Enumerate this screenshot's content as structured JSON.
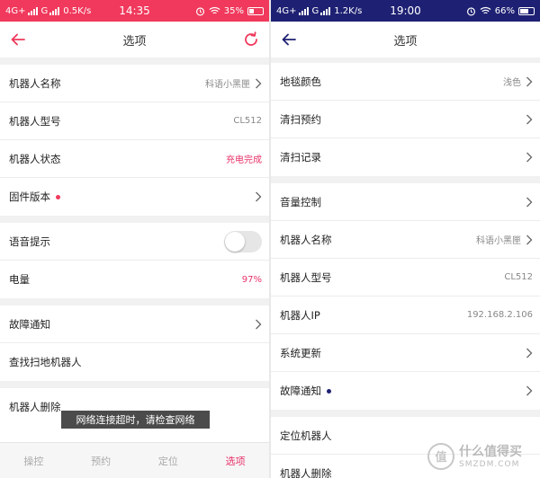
{
  "colors": {
    "left_accent": "#f0395c",
    "right_accent": "#1e2173",
    "value_accent": "#e8336a"
  },
  "left": {
    "status": {
      "network": "4G+",
      "signal2": "G",
      "speed": "0.5K/s",
      "time": "14:35",
      "battery": "35%",
      "battery_level": 0.35
    },
    "header": {
      "title": "选项"
    },
    "rows": {
      "robot_name": {
        "label": "机器人名称",
        "value": "科语小黑匣"
      },
      "robot_model": {
        "label": "机器人型号",
        "value": "CL512"
      },
      "robot_status": {
        "label": "机器人状态",
        "value": "充电完成"
      },
      "firmware": {
        "label": "固件版本"
      },
      "voice_prompt": {
        "label": "语音提示",
        "enabled": false
      },
      "battery": {
        "label": "电量",
        "value": "97%"
      },
      "fault_notice": {
        "label": "故障通知"
      },
      "find_robot": {
        "label": "查找扫地机器人"
      },
      "delete_robot": {
        "label": "机器人删除"
      }
    },
    "toast": "网络连接超时，请检查网络",
    "tabs": [
      "操控",
      "预约",
      "定位",
      "选项"
    ],
    "active_tab": "选项"
  },
  "right": {
    "status": {
      "network": "4G+",
      "signal2": "G",
      "speed": "1.2K/s",
      "time": "19:00",
      "battery": "66%",
      "battery_level": 0.66
    },
    "header": {
      "title": "选项"
    },
    "rows": {
      "carpet_color": {
        "label": "地毯颜色",
        "value": "浅色"
      },
      "clean_schedule": {
        "label": "清扫预约"
      },
      "clean_record": {
        "label": "清扫记录"
      },
      "volume": {
        "label": "音量控制"
      },
      "robot_name": {
        "label": "机器人名称",
        "value": "科语小黑匣"
      },
      "robot_model": {
        "label": "机器人型号",
        "value": "CL512"
      },
      "robot_ip": {
        "label": "机器人IP",
        "value": "192.168.2.106"
      },
      "system_update": {
        "label": "系统更新"
      },
      "fault_notice": {
        "label": "故障通知"
      },
      "locate_robot": {
        "label": "定位机器人"
      },
      "delete_robot": {
        "label": "机器人删除"
      }
    }
  },
  "watermark": {
    "name": "什么值得买",
    "url": "SMZDM.COM"
  }
}
